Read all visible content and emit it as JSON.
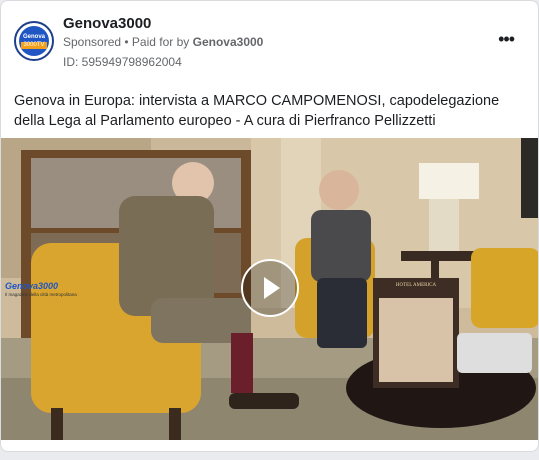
{
  "post": {
    "page_name": "Genova3000",
    "avatar": {
      "line1": "Genova",
      "line2": "3000TV"
    },
    "sponsored_label": "Sponsored",
    "separator": " • ",
    "paid_for_label": "Paid for by ",
    "paid_for_name": "Genova3000",
    "ad_id": "ID: 595949798962004",
    "menu_icon": "more-horizontal-icon",
    "caption": "Genova in Europa: intervista a MARCO CAMPOMENOSI, capodelegazione della Lega al Parlamento europeo - A cura di Pierfranco Pellizzetti"
  },
  "video": {
    "watermark": "Genova3000",
    "watermark_sub": "Il magazine della città metropolitana",
    "book_title": "HOTEL AMERICA",
    "play_icon": "play-icon"
  }
}
